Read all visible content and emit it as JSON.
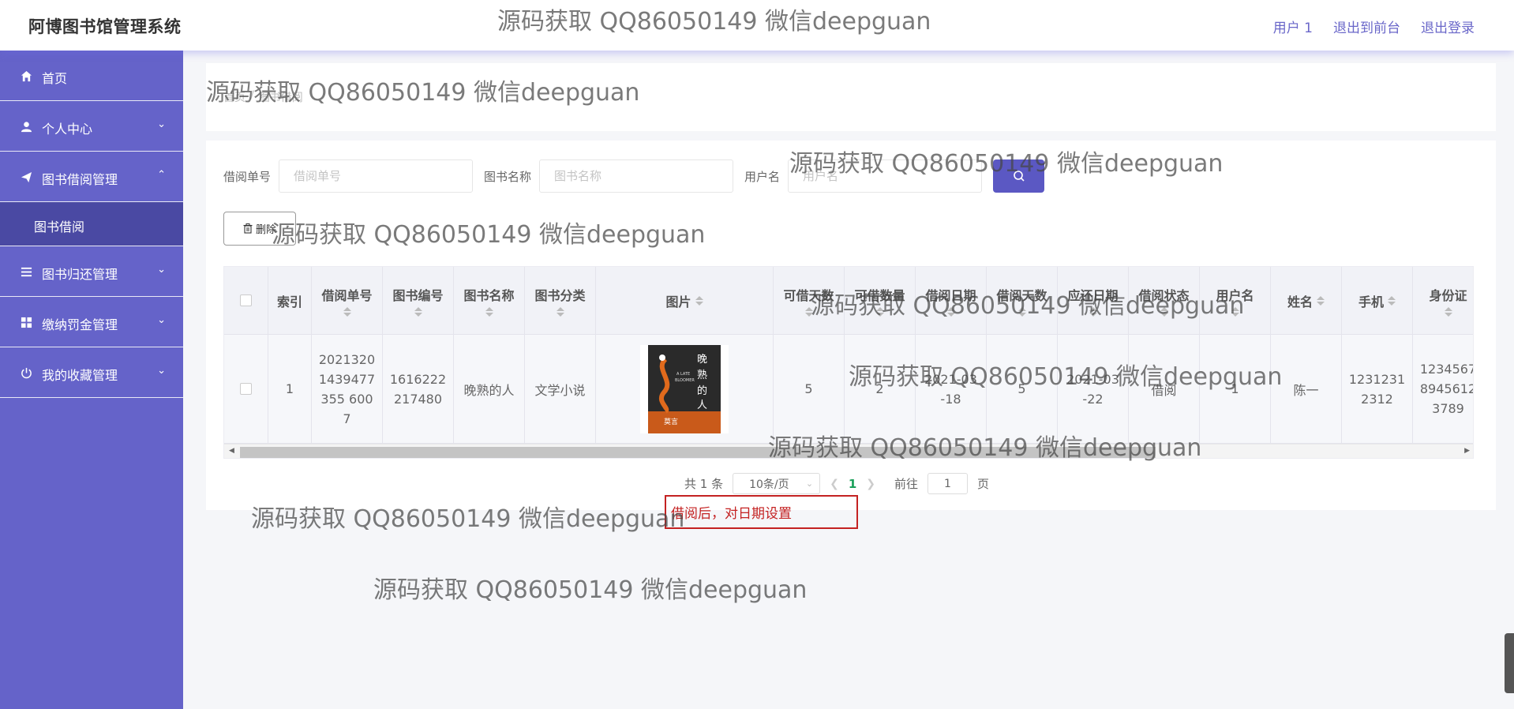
{
  "header": {
    "title": "阿博图书馆管理系统",
    "links": [
      "用户 1",
      "退出到前台",
      "退出登录"
    ]
  },
  "sidebar": {
    "items": [
      {
        "label": "首页",
        "icon": "home-icon",
        "arrow": ""
      },
      {
        "label": "个人中心",
        "icon": "user-icon",
        "arrow": "chevron-down"
      },
      {
        "label": "图书借阅管理",
        "icon": "send-icon",
        "arrow": "chevron-up"
      },
      {
        "label": "图书归还管理",
        "icon": "list-icon",
        "arrow": "chevron-down"
      },
      {
        "label": "缴纳罚金管理",
        "icon": "grid-icon",
        "arrow": "chevron-down"
      },
      {
        "label": "我的收藏管理",
        "icon": "power-icon",
        "arrow": "chevron-down"
      }
    ],
    "submenu": {
      "label": "图书借阅"
    },
    "accent_color": "#6563c9"
  },
  "breadcrumb": {
    "home": "首页",
    "separator": "/",
    "current": "图书借阅"
  },
  "search": {
    "fields": [
      {
        "label": "借阅单号",
        "placeholder": "借阅单号"
      },
      {
        "label": "图书名称",
        "placeholder": "图书名称"
      },
      {
        "label": "用户名",
        "placeholder": "用户名"
      }
    ],
    "button_icon": "search-icon"
  },
  "toolbar": {
    "delete_label": "删除",
    "delete_icon": "trash-icon"
  },
  "table": {
    "columns": [
      "索引",
      "借阅单号",
      "图书编号",
      "图书名称",
      "图书分类",
      "图片",
      "可借天数",
      "可借数量",
      "借阅日期",
      "借阅天数",
      "应还日期",
      "借阅状态",
      "用户名",
      "姓名",
      "手机",
      "身份证"
    ],
    "rows": [
      {
        "index": "1",
        "borrow_no": "20213201439477355 6007",
        "book_no": "1616222217480",
        "book_name": "晚熟的人",
        "category": "文学小说",
        "image_title": "晚熟的人",
        "image_subtitle": "A LATE BLOOMER",
        "loan_days": "5",
        "loan_qty": "2",
        "borrow_date": "2021-03-18",
        "borrow_days": "5",
        "due_date": "2021-03-22",
        "status": "借阅",
        "username": "1",
        "name": "陈一",
        "phone": "12312312312",
        "id_card": "123456789456123789"
      }
    ]
  },
  "pagination": {
    "total": "共 1 条",
    "page_size": "10条/页",
    "current_page": "1",
    "goto_label": "前往",
    "goto_value": "1",
    "page_suffix": "页"
  },
  "annotation": {
    "text": "借阅后，对日期设置"
  },
  "watermark": {
    "text": "源码获取 QQ86050149 微信deepguan"
  }
}
